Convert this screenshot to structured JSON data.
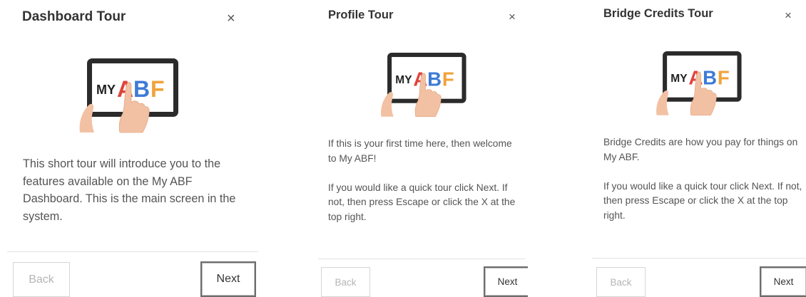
{
  "tours": [
    {
      "title": "Dashboard Tour",
      "close_icon": "×",
      "logo": {
        "my": "MY",
        "a": "A",
        "b": "B",
        "f": "F"
      },
      "paragraphs": [
        "This short tour will introduce you to the features available on the My ABF Dashboard. This is the main screen in the system."
      ],
      "back_label": "Back",
      "next_label": "Next"
    },
    {
      "title": "Profile Tour",
      "close_icon": "×",
      "logo": {
        "my": "MY",
        "a": "A",
        "b": "B",
        "f": "F"
      },
      "paragraphs": [
        "If this is your first time here, then welcome to My ABF!",
        "If you would like a quick tour click Next. If not, then press Escape or click the X at the top right."
      ],
      "back_label": "Back",
      "next_label": "Next"
    },
    {
      "title": "Bridge Credits Tour",
      "close_icon": "×",
      "logo": {
        "my": "MY",
        "a": "A",
        "b": "B",
        "f": "F"
      },
      "paragraphs": [
        "Bridge Credits are how you pay for things on My ABF.",
        "If you would like a quick tour click Next. If not, then press Escape or click the X at the top right."
      ],
      "back_label": "Back",
      "next_label": "Next"
    }
  ],
  "colors": {
    "logo_a": "#e0433c",
    "logo_b": "#3d7bd6",
    "logo_f": "#f0a33a",
    "text": "#545454",
    "title": "#333333"
  }
}
